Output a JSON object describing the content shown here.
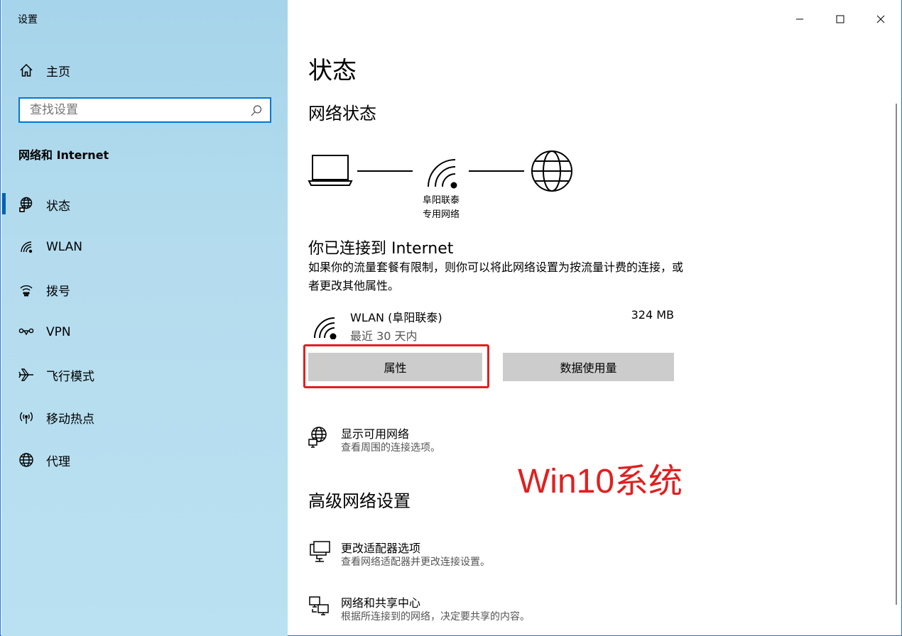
{
  "window": {
    "title": "设置"
  },
  "sidebar": {
    "home_label": "主页",
    "search_placeholder": "查找设置",
    "section_title": "网络和 Internet",
    "items": [
      {
        "label": "状态",
        "icon": "globe-status-icon",
        "active": true
      },
      {
        "label": "WLAN",
        "icon": "wifi-icon"
      },
      {
        "label": "拨号",
        "icon": "dialup-icon"
      },
      {
        "label": "VPN",
        "icon": "vpn-icon"
      },
      {
        "label": "飞行模式",
        "icon": "airplane-icon"
      },
      {
        "label": "移动热点",
        "icon": "hotspot-icon"
      },
      {
        "label": "代理",
        "icon": "globe-icon"
      }
    ]
  },
  "main": {
    "title": "状态",
    "network_status_title": "网络状态",
    "diagram_caption_line1": "阜阳联泰",
    "diagram_caption_line2": "专用网络",
    "connected_title": "你已连接到 Internet",
    "connected_desc": "如果你的流量套餐有限制，则你可以将此网络设置为按流量计费的连接，或者更改其他属性。",
    "network": {
      "name": "WLAN (阜阳联泰)",
      "period": "最近 30 天内",
      "usage": "324 MB"
    },
    "buttons": {
      "properties": "属性",
      "data_usage": "数据使用量"
    },
    "show_networks": {
      "title": "显示可用网络",
      "subtitle": "查看周围的连接选项。"
    },
    "advanced_title": "高级网络设置",
    "adapter": {
      "title": "更改适配器选项",
      "subtitle": "查看网络适配器并更改连接设置。"
    },
    "sharing": {
      "title": "网络和共享中心",
      "subtitle": "根据所连接到的网络，决定要共享的内容。"
    }
  },
  "watermark": "Win10系统",
  "colors": {
    "accent": "#0078d7",
    "highlight": "#e02020",
    "button_bg": "#cccccc"
  }
}
